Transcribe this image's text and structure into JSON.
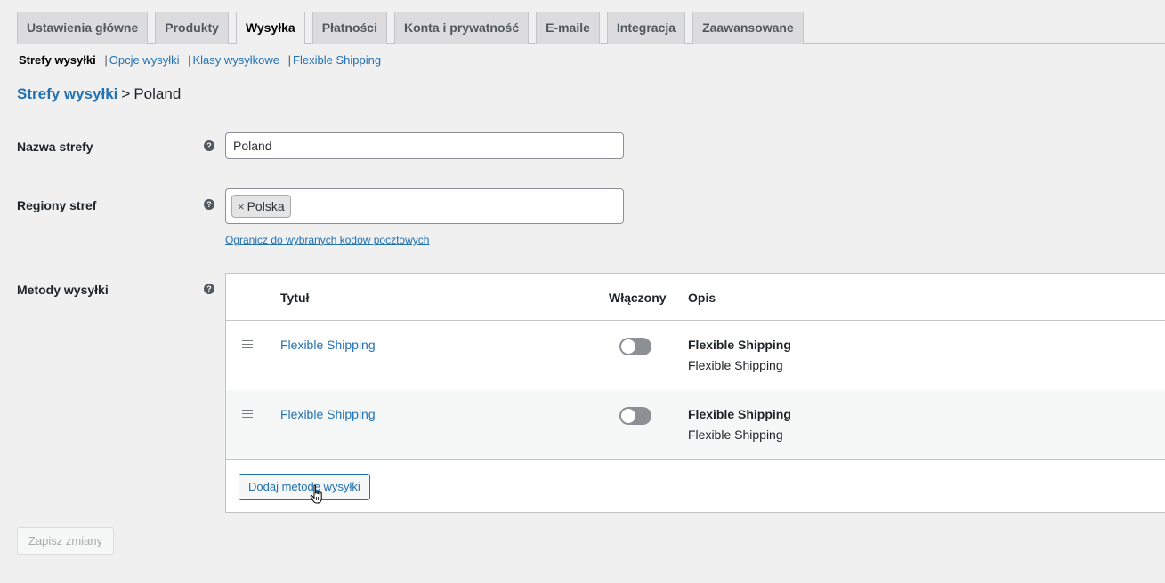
{
  "tabs": [
    {
      "label": "Ustawienia główne"
    },
    {
      "label": "Produkty"
    },
    {
      "label": "Wysyłka",
      "active": true
    },
    {
      "label": "Płatności"
    },
    {
      "label": "Konta i prywatność"
    },
    {
      "label": "E-maile"
    },
    {
      "label": "Integracja"
    },
    {
      "label": "Zaawansowane"
    }
  ],
  "subnav": {
    "current": "Strefy wysyłki",
    "links": [
      "Opcje wysyłki",
      "Klasy wysyłkowe",
      "Flexible Shipping"
    ],
    "separator": "|"
  },
  "breadcrumb": {
    "link": "Strefy wysyłki",
    "separator": ">",
    "current": "Poland"
  },
  "form": {
    "zone_name_label": "Nazwa strefy",
    "zone_name_value": "Poland",
    "zone_regions_label": "Regiony stref",
    "region_chip": "Polska",
    "chip_remove": "×",
    "postcode_link": "Ogranicz do wybranych kodów pocztowych",
    "methods_label": "Metody wysyłki",
    "help_glyph": "?"
  },
  "methods_table": {
    "col_title": "Tytuł",
    "col_enabled": "Włączony",
    "col_description": "Opis",
    "rows": [
      {
        "title": "Flexible Shipping",
        "enabled": false,
        "desc_title": "Flexible Shipping",
        "desc_sub": "Flexible Shipping"
      },
      {
        "title": "Flexible Shipping",
        "enabled": false,
        "desc_title": "Flexible Shipping",
        "desc_sub": "Flexible Shipping"
      }
    ],
    "add_button": "Dodaj metodę wysyłki"
  },
  "save_button": "Zapisz zmiany",
  "colors": {
    "link": "#2271b1",
    "toggle_off": "#8c8f94",
    "background": "#f0f0f1"
  },
  "icons": {
    "help": "help-icon",
    "drag": "drag-handle-icon",
    "cursor": "hand-pointer-cursor-icon"
  }
}
